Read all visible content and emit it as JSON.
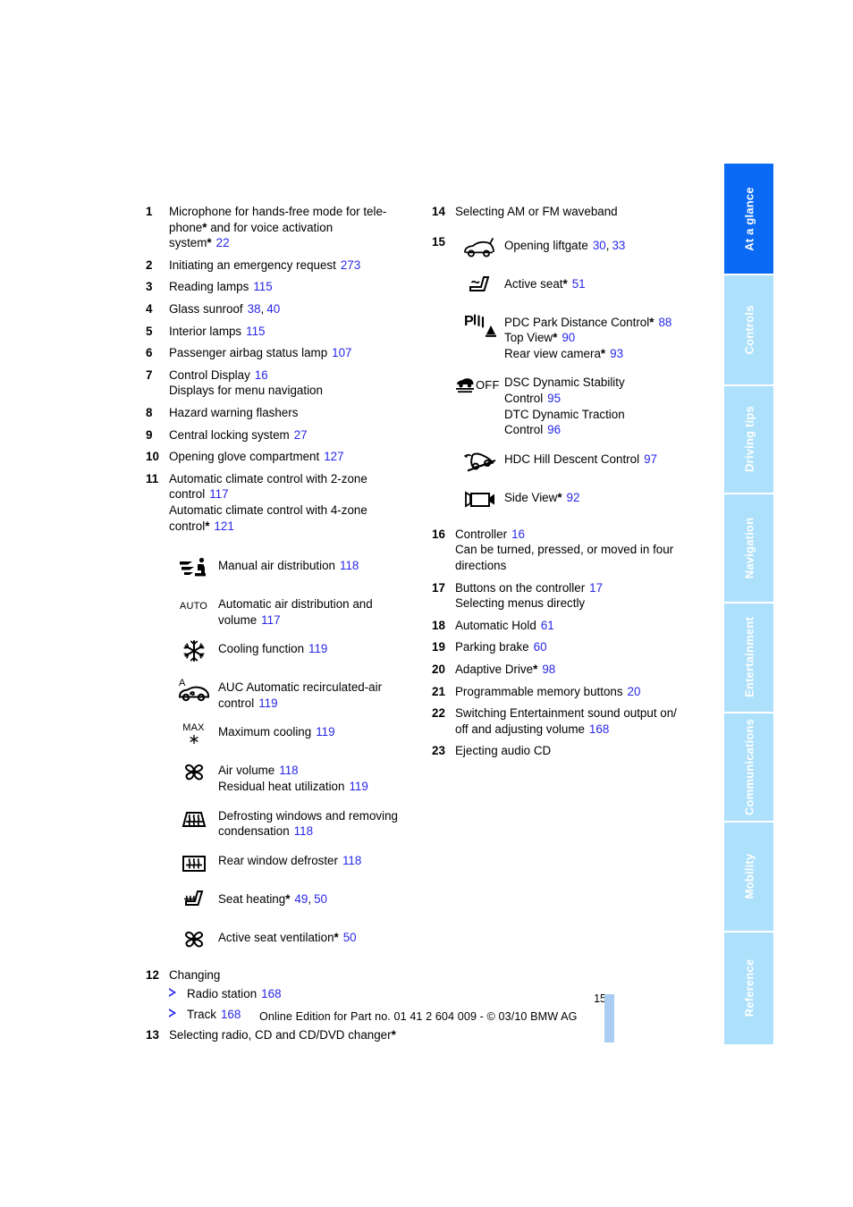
{
  "document": {
    "page_number": "15",
    "footer": "Online Edition for Part no. 01 41 2 604 009 - © 03/10 BMW AG",
    "link_color": "#2727e8",
    "tab_active_color": "#0a6af5",
    "tab_inactive_color": "#ade0fb"
  },
  "tabs": [
    {
      "label": "At a glance",
      "active": true
    },
    {
      "label": "Controls",
      "active": false
    },
    {
      "label": "Driving tips",
      "active": false
    },
    {
      "label": "Navigation",
      "active": false
    },
    {
      "label": "Entertainment",
      "active": false
    },
    {
      "label": "Communications",
      "active": false
    },
    {
      "label": "Mobility",
      "active": false
    },
    {
      "label": "Reference",
      "active": false
    }
  ],
  "left_column": {
    "item1": {
      "num": "1",
      "line1": "Microphone for hands-free mode for tele-",
      "line2a": "phone",
      "line2b": " and for voice activation",
      "line3a": "system",
      "page": "22"
    },
    "item2": {
      "num": "2",
      "text": "Initiating an emergency request",
      "page": "273"
    },
    "item3": {
      "num": "3",
      "text": "Reading lamps",
      "page": "115"
    },
    "item4": {
      "num": "4",
      "text": "Glass sunroof",
      "page": "38",
      "page2": "40"
    },
    "item5": {
      "num": "5",
      "text": "Interior lamps",
      "page": "115"
    },
    "item6": {
      "num": "6",
      "text": "Passenger airbag status lamp",
      "page": "107"
    },
    "item7": {
      "num": "7",
      "text": "Control Display",
      "page": "16",
      "sub": "Displays for menu navigation"
    },
    "item8": {
      "num": "8",
      "text": "Hazard warning flashers"
    },
    "item9": {
      "num": "9",
      "text": "Central locking system",
      "page": "27"
    },
    "item10": {
      "num": "10",
      "text": "Opening glove compartment",
      "page": "127"
    },
    "item11": {
      "num": "11",
      "line1": "Automatic climate control with 2-zone",
      "line2": "control",
      "page1": "117",
      "line3": "Automatic climate control with 4-zone",
      "line4": "control",
      "page2": "121"
    },
    "climate_icons": [
      {
        "icon": "manual-air-distribution-icon",
        "label": "Manual air distribution",
        "page": "118"
      },
      {
        "icon": "auto-icon",
        "label_line1": "Automatic air distribution and",
        "label_line2": "volume",
        "page": "117"
      },
      {
        "icon": "snowflake-cooling-icon",
        "label": "Cooling function",
        "page": "119"
      },
      {
        "icon": "auc-recirculated-air-icon",
        "label_line1": "AUC Automatic recirculated-air",
        "label_line2": "control",
        "page": "119"
      },
      {
        "icon": "max-cooling-icon",
        "label": "Maximum cooling",
        "page": "119"
      },
      {
        "icon": "fan-air-volume-icon",
        "label_line1": "Air volume",
        "page1": "118",
        "label_line2": "Residual heat utilization",
        "page2": "119"
      },
      {
        "icon": "windshield-defrost-icon",
        "label_line1": "Defrosting windows and removing",
        "label_line2": "condensation",
        "page": "118"
      },
      {
        "icon": "rear-window-defroster-icon",
        "label": "Rear window defroster",
        "page": "118"
      },
      {
        "icon": "seat-heating-icon",
        "label": "Seat heating",
        "star": true,
        "page": "49",
        "page2": "50"
      },
      {
        "icon": "active-seat-ventilation-icon",
        "label": "Active seat ventilation",
        "star": true,
        "page": "50"
      }
    ],
    "item12": {
      "num": "12",
      "text": "Changing",
      "subitems": [
        {
          "label": "Radio station",
          "page": "168"
        },
        {
          "label": "Track",
          "page": "168"
        }
      ]
    },
    "item13": {
      "num": "13",
      "text": "Selecting radio, CD and CD/DVD changer",
      "star": true
    }
  },
  "right_column": {
    "item14": {
      "num": "14",
      "text": "Selecting AM or FM waveband"
    },
    "item15": {
      "num": "15",
      "icons": [
        {
          "icon": "liftgate-icon",
          "label": "Opening liftgate",
          "page": "30",
          "page2": "33"
        },
        {
          "icon": "active-seat-icon",
          "label": "Active seat",
          "star": true,
          "page": "51"
        },
        {
          "icon": "pdc-park-distance-icon",
          "label_line1": "PDC Park Distance Control",
          "star1": true,
          "page1": "88",
          "label_line2": "Top View",
          "star2": true,
          "page2": "90",
          "label_line3": "Rear view camera",
          "star3": true,
          "page3": "93"
        },
        {
          "icon": "dsc-off-icon",
          "label_line1": "DSC Dynamic Stability",
          "label_line2": "Control",
          "page1": "95",
          "label_line3": "DTC Dynamic Traction",
          "label_line4": "Control",
          "page2": "96"
        },
        {
          "icon": "hdc-hill-descent-icon",
          "label": "HDC Hill Descent Control",
          "page": "97"
        },
        {
          "icon": "side-view-camera-icon",
          "label": "Side View",
          "star": true,
          "page": "92"
        }
      ]
    },
    "item16": {
      "num": "16",
      "text": "Controller",
      "page": "16",
      "sub1": "Can be turned, pressed, or moved in four",
      "sub2": "directions"
    },
    "item17": {
      "num": "17",
      "text": "Buttons on the controller",
      "page": "17",
      "sub": "Selecting menus directly"
    },
    "item18": {
      "num": "18",
      "text": "Automatic Hold",
      "page": "61"
    },
    "item19": {
      "num": "19",
      "text": "Parking brake",
      "page": "60"
    },
    "item20": {
      "num": "20",
      "text": "Adaptive Drive",
      "star": true,
      "page": "98"
    },
    "item21": {
      "num": "21",
      "text": "Programmable memory buttons",
      "page": "20"
    },
    "item22": {
      "num": "22",
      "line1": "Switching Entertainment sound output on/",
      "line2": "off and adjusting volume",
      "page": "168"
    },
    "item23": {
      "num": "23",
      "text": "Ejecting audio CD"
    }
  },
  "icon_glyphs": {
    "auto_text": "AUTO",
    "max_text": "MAX",
    "off_text": "OFF",
    "auc_letter": "A",
    "pdc_letter": "P"
  }
}
